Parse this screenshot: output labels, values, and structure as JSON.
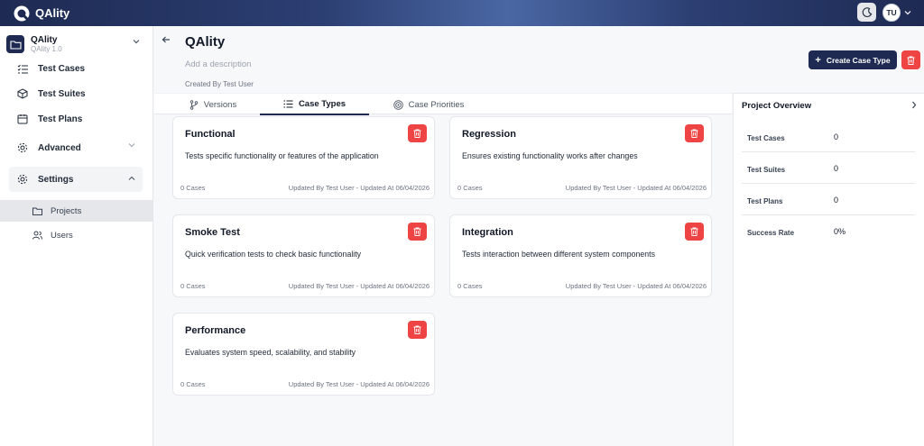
{
  "app": {
    "name": "QAlity"
  },
  "topbar": {
    "avatar_initials": "TU"
  },
  "sidebar": {
    "project_name": "QAlity",
    "project_version": "QAlity 1.0",
    "items": [
      {
        "label": "Test Cases",
        "icon": "list-check-icon"
      },
      {
        "label": "Test Suites",
        "icon": "box-icon"
      },
      {
        "label": "Test Plans",
        "icon": "calendar-icon"
      },
      {
        "label": "Advanced",
        "icon": "gear-icon"
      },
      {
        "label": "Settings",
        "icon": "gear-icon"
      }
    ],
    "sub_items": [
      {
        "label": "Projects",
        "icon": "folder-icon"
      },
      {
        "label": "Users",
        "icon": "users-icon"
      }
    ]
  },
  "page": {
    "title": "QAlity",
    "description_placeholder": "Add a description",
    "created_by": "Created By Test User",
    "create_button": "Create Case Type"
  },
  "tabs": [
    {
      "label": "Versions",
      "icon": "branch-icon"
    },
    {
      "label": "Case Types",
      "icon": "list-icon"
    },
    {
      "label": "Case Priorities",
      "icon": "target-icon"
    }
  ],
  "cards": [
    {
      "title": "Functional",
      "description": "Tests specific functionality or features of the application",
      "cases": "0 Cases",
      "updated": "Updated By Test User - Updated At 06/04/2026"
    },
    {
      "title": "Regression",
      "description": "Ensures existing functionality works after changes",
      "cases": "0 Cases",
      "updated": "Updated By Test User - Updated At 06/04/2026"
    },
    {
      "title": "Smoke Test",
      "description": "Quick verification tests to check basic functionality",
      "cases": "0 Cases",
      "updated": "Updated By Test User - Updated At 06/04/2026"
    },
    {
      "title": "Integration",
      "description": "Tests interaction between different system components",
      "cases": "0 Cases",
      "updated": "Updated By Test User - Updated At 06/04/2026"
    },
    {
      "title": "Performance",
      "description": "Evaluates system speed, scalability, and stability",
      "cases": "0 Cases",
      "updated": "Updated By Test User - Updated At 06/04/2026"
    }
  ],
  "overview": {
    "title": "Project Overview",
    "stats": [
      {
        "label": "Test Cases",
        "value": "0"
      },
      {
        "label": "Test Suites",
        "value": "0"
      },
      {
        "label": "Test Plans",
        "value": "0"
      },
      {
        "label": "Success Rate",
        "value": "0%"
      }
    ]
  },
  "colors": {
    "primary": "#1e2a52",
    "danger": "#ef4444"
  }
}
